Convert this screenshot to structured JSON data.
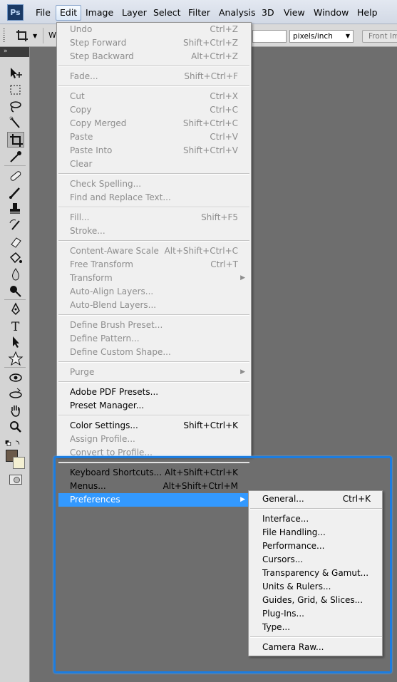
{
  "app": {
    "logo": "Ps"
  },
  "menubar": {
    "items": [
      "File",
      "Edit",
      "Image",
      "Layer",
      "Select",
      "Filter",
      "Analysis",
      "3D",
      "View",
      "Window",
      "Help"
    ],
    "active": "Edit"
  },
  "options_bar": {
    "w_label": "W",
    "resolution_units": "pixels/inch",
    "front_image_label": "Front Im"
  },
  "tools_panel": {
    "collapse_label": "»"
  },
  "colors": {
    "accent": "#3399ff",
    "highlight_box": "#1c7de0",
    "foreground_swatch": "#6b5a4a",
    "background_swatch": "#f4f0d2"
  },
  "edit_menu": {
    "groups": [
      [
        {
          "label": "Undo",
          "shortcut": "Ctrl+Z",
          "enabled": false
        },
        {
          "label": "Step Forward",
          "shortcut": "Shift+Ctrl+Z",
          "enabled": false
        },
        {
          "label": "Step Backward",
          "shortcut": "Alt+Ctrl+Z",
          "enabled": false
        }
      ],
      [
        {
          "label": "Fade...",
          "shortcut": "Shift+Ctrl+F",
          "enabled": false
        }
      ],
      [
        {
          "label": "Cut",
          "shortcut": "Ctrl+X",
          "enabled": false
        },
        {
          "label": "Copy",
          "shortcut": "Ctrl+C",
          "enabled": false
        },
        {
          "label": "Copy Merged",
          "shortcut": "Shift+Ctrl+C",
          "enabled": false
        },
        {
          "label": "Paste",
          "shortcut": "Ctrl+V",
          "enabled": false
        },
        {
          "label": "Paste Into",
          "shortcut": "Shift+Ctrl+V",
          "enabled": false
        },
        {
          "label": "Clear",
          "shortcut": "",
          "enabled": false
        }
      ],
      [
        {
          "label": "Check Spelling...",
          "shortcut": "",
          "enabled": false
        },
        {
          "label": "Find and Replace Text...",
          "shortcut": "",
          "enabled": false
        }
      ],
      [
        {
          "label": "Fill...",
          "shortcut": "Shift+F5",
          "enabled": false
        },
        {
          "label": "Stroke...",
          "shortcut": "",
          "enabled": false
        }
      ],
      [
        {
          "label": "Content-Aware Scale",
          "shortcut": "Alt+Shift+Ctrl+C",
          "enabled": false
        },
        {
          "label": "Free Transform",
          "shortcut": "Ctrl+T",
          "enabled": false
        },
        {
          "label": "Transform",
          "shortcut": "",
          "enabled": false,
          "submenu": true
        },
        {
          "label": "Auto-Align Layers...",
          "shortcut": "",
          "enabled": false
        },
        {
          "label": "Auto-Blend Layers...",
          "shortcut": "",
          "enabled": false
        }
      ],
      [
        {
          "label": "Define Brush Preset...",
          "shortcut": "",
          "enabled": false
        },
        {
          "label": "Define Pattern...",
          "shortcut": "",
          "enabled": false
        },
        {
          "label": "Define Custom Shape...",
          "shortcut": "",
          "enabled": false
        }
      ],
      [
        {
          "label": "Purge",
          "shortcut": "",
          "enabled": false,
          "submenu": true
        }
      ],
      [
        {
          "label": "Adobe PDF Presets...",
          "shortcut": "",
          "enabled": true
        },
        {
          "label": "Preset Manager...",
          "shortcut": "",
          "enabled": true
        }
      ],
      [
        {
          "label": "Color Settings...",
          "shortcut": "Shift+Ctrl+K",
          "enabled": true
        },
        {
          "label": "Assign Profile...",
          "shortcut": "",
          "enabled": false
        },
        {
          "label": "Convert to Profile...",
          "shortcut": "",
          "enabled": false
        }
      ],
      [
        {
          "label": "Keyboard Shortcuts...",
          "shortcut": "Alt+Shift+Ctrl+K",
          "enabled": true
        },
        {
          "label": "Menus...",
          "shortcut": "Alt+Shift+Ctrl+M",
          "enabled": true
        },
        {
          "label": "Preferences",
          "shortcut": "",
          "enabled": true,
          "submenu": true,
          "highlighted": true
        }
      ]
    ]
  },
  "preferences_menu": {
    "groups": [
      [
        {
          "label": "General...",
          "shortcut": "Ctrl+K"
        }
      ],
      [
        {
          "label": "Interface...",
          "shortcut": ""
        },
        {
          "label": "File Handling...",
          "shortcut": ""
        },
        {
          "label": "Performance...",
          "shortcut": ""
        },
        {
          "label": "Cursors...",
          "shortcut": ""
        },
        {
          "label": "Transparency & Gamut...",
          "shortcut": ""
        },
        {
          "label": "Units & Rulers...",
          "shortcut": ""
        },
        {
          "label": "Guides, Grid, & Slices...",
          "shortcut": ""
        },
        {
          "label": "Plug-Ins...",
          "shortcut": ""
        },
        {
          "label": "Type...",
          "shortcut": ""
        }
      ],
      [
        {
          "label": "Camera Raw...",
          "shortcut": ""
        }
      ]
    ]
  }
}
